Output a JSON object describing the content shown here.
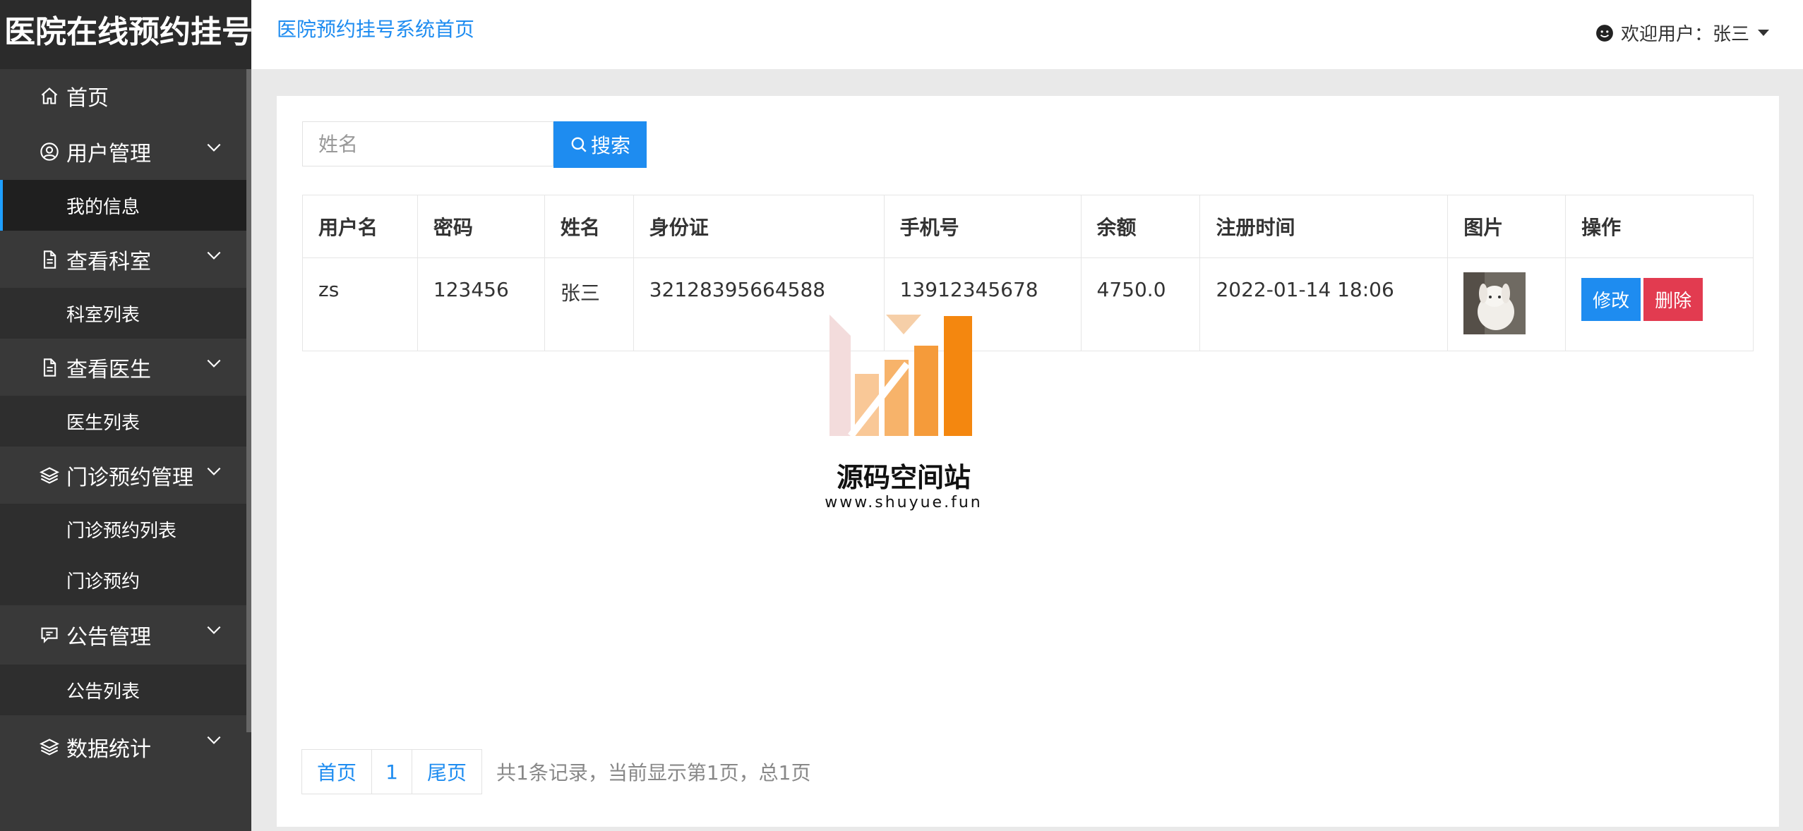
{
  "brand": "医院在线预约挂号",
  "header": {
    "home_link": "医院预约挂号系统首页",
    "welcome": "欢迎用户：张三"
  },
  "sidebar": {
    "home": "首页",
    "user_mgmt": "用户管理",
    "my_info": "我的信息",
    "dept": "查看科室",
    "dept_list": "科室列表",
    "doctor": "查看医生",
    "doctor_list": "医生列表",
    "appt_mgmt": "门诊预约管理",
    "appt_list": "门诊预约列表",
    "appt": "门诊预约",
    "notice_mgmt": "公告管理",
    "notice_list": "公告列表",
    "stats": "数据统计"
  },
  "search": {
    "placeholder": "姓名",
    "button": "搜索"
  },
  "table": {
    "headers": [
      "用户名",
      "密码",
      "姓名",
      "身份证",
      "手机号",
      "余额",
      "注册时间",
      "图片",
      "操作"
    ],
    "rows": [
      {
        "username": "zs",
        "password": "123456",
        "name": "张三",
        "id_card": "32128395664588",
        "phone": "13912345678",
        "balance": "4750.0",
        "reg_time": "2022-01-14 18:06",
        "edit": "修改",
        "delete": "删除"
      }
    ]
  },
  "pagination": {
    "first": "首页",
    "page": "1",
    "last": "尾页",
    "info": "共1条记录，当前显示第1页，总1页"
  },
  "watermark": {
    "title": "源码空间站",
    "url": "www.shuyue.fun"
  },
  "colors": {
    "accent": "#1e8cf0",
    "danger": "#e23b50",
    "sidebar": "#393939"
  }
}
